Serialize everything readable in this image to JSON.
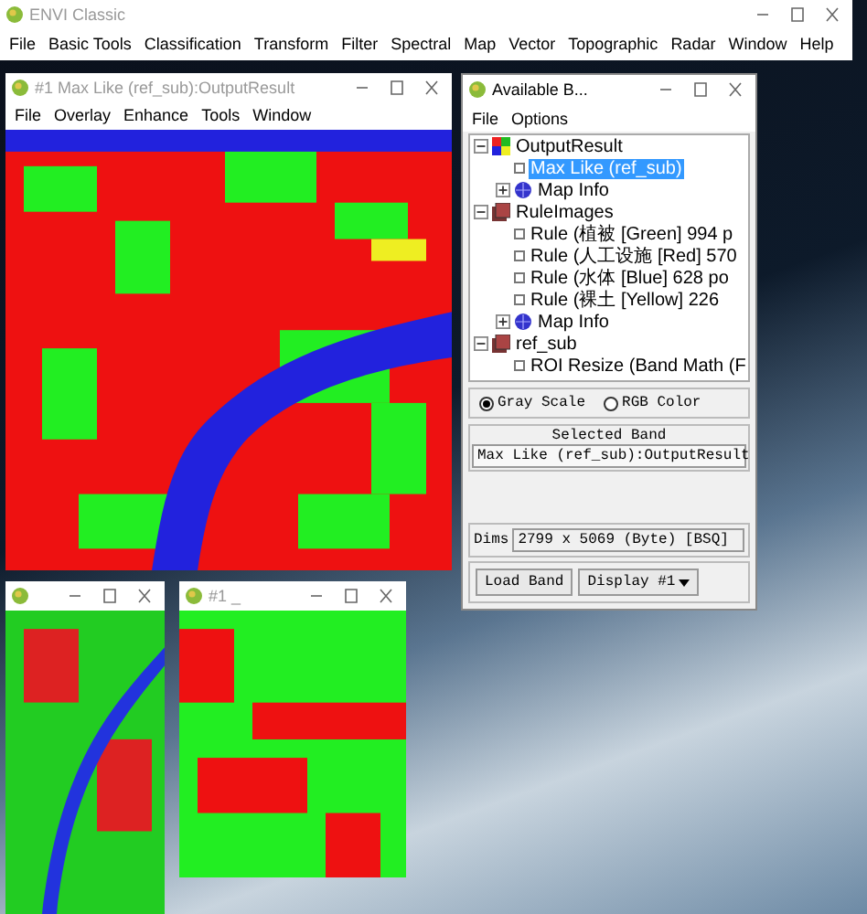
{
  "main_window": {
    "title": "ENVI Classic",
    "menu": [
      "File",
      "Basic Tools",
      "Classification",
      "Transform",
      "Filter",
      "Spectral",
      "Map",
      "Vector",
      "Topographic",
      "Radar",
      "Window",
      "Help"
    ]
  },
  "display_window": {
    "title": "#1 Max Like (ref_sub):OutputResult",
    "menu": [
      "File",
      "Overlay",
      "Enhance",
      "Tools",
      "Window"
    ]
  },
  "bands_window": {
    "title": "Available B...",
    "menu": [
      "File",
      "Options"
    ],
    "tree": [
      {
        "label": "OutputResult",
        "kind": "classification",
        "expanded": true,
        "children": [
          {
            "label": "Max Like (ref_sub)",
            "kind": "band",
            "selected": true
          },
          {
            "label": "Map Info",
            "kind": "map",
            "expanded": false,
            "selected": false
          }
        ]
      },
      {
        "label": "RuleImages",
        "kind": "file",
        "expanded": true,
        "children": [
          {
            "label": "Rule (植被 [Green] 994 p",
            "kind": "band",
            "selected": false
          },
          {
            "label": "Rule (人工设施 [Red] 570",
            "kind": "band",
            "selected": false
          },
          {
            "label": "Rule (水体 [Blue] 628 po",
            "kind": "band",
            "selected": false
          },
          {
            "label": "Rule (裸土 [Yellow] 226",
            "kind": "band",
            "selected": false
          },
          {
            "label": "Map Info",
            "kind": "map",
            "expanded": false,
            "selected": false
          }
        ]
      },
      {
        "label": "ref_sub",
        "kind": "file",
        "expanded": true,
        "children": [
          {
            "label": "ROI Resize (Band Math (F",
            "kind": "band",
            "selected": false
          }
        ]
      }
    ],
    "color_modes": [
      {
        "label": "Gray Scale",
        "selected": true
      },
      {
        "label": "RGB Color",
        "selected": false
      }
    ],
    "selected_band": {
      "heading": "Selected Band",
      "value": "Max Like (ref_sub):OutputResult"
    },
    "dims": {
      "label": "Dims",
      "value": "2799 x 5069 (Byte) [BSQ]"
    },
    "buttons": [
      {
        "label": "Load Band",
        "kind": "button"
      },
      {
        "label": "Display #1",
        "kind": "dropdown"
      }
    ]
  },
  "small_windows": [
    {
      "kind": "overview"
    },
    {
      "kind": "zoom",
      "title": "#1 _"
    }
  ]
}
